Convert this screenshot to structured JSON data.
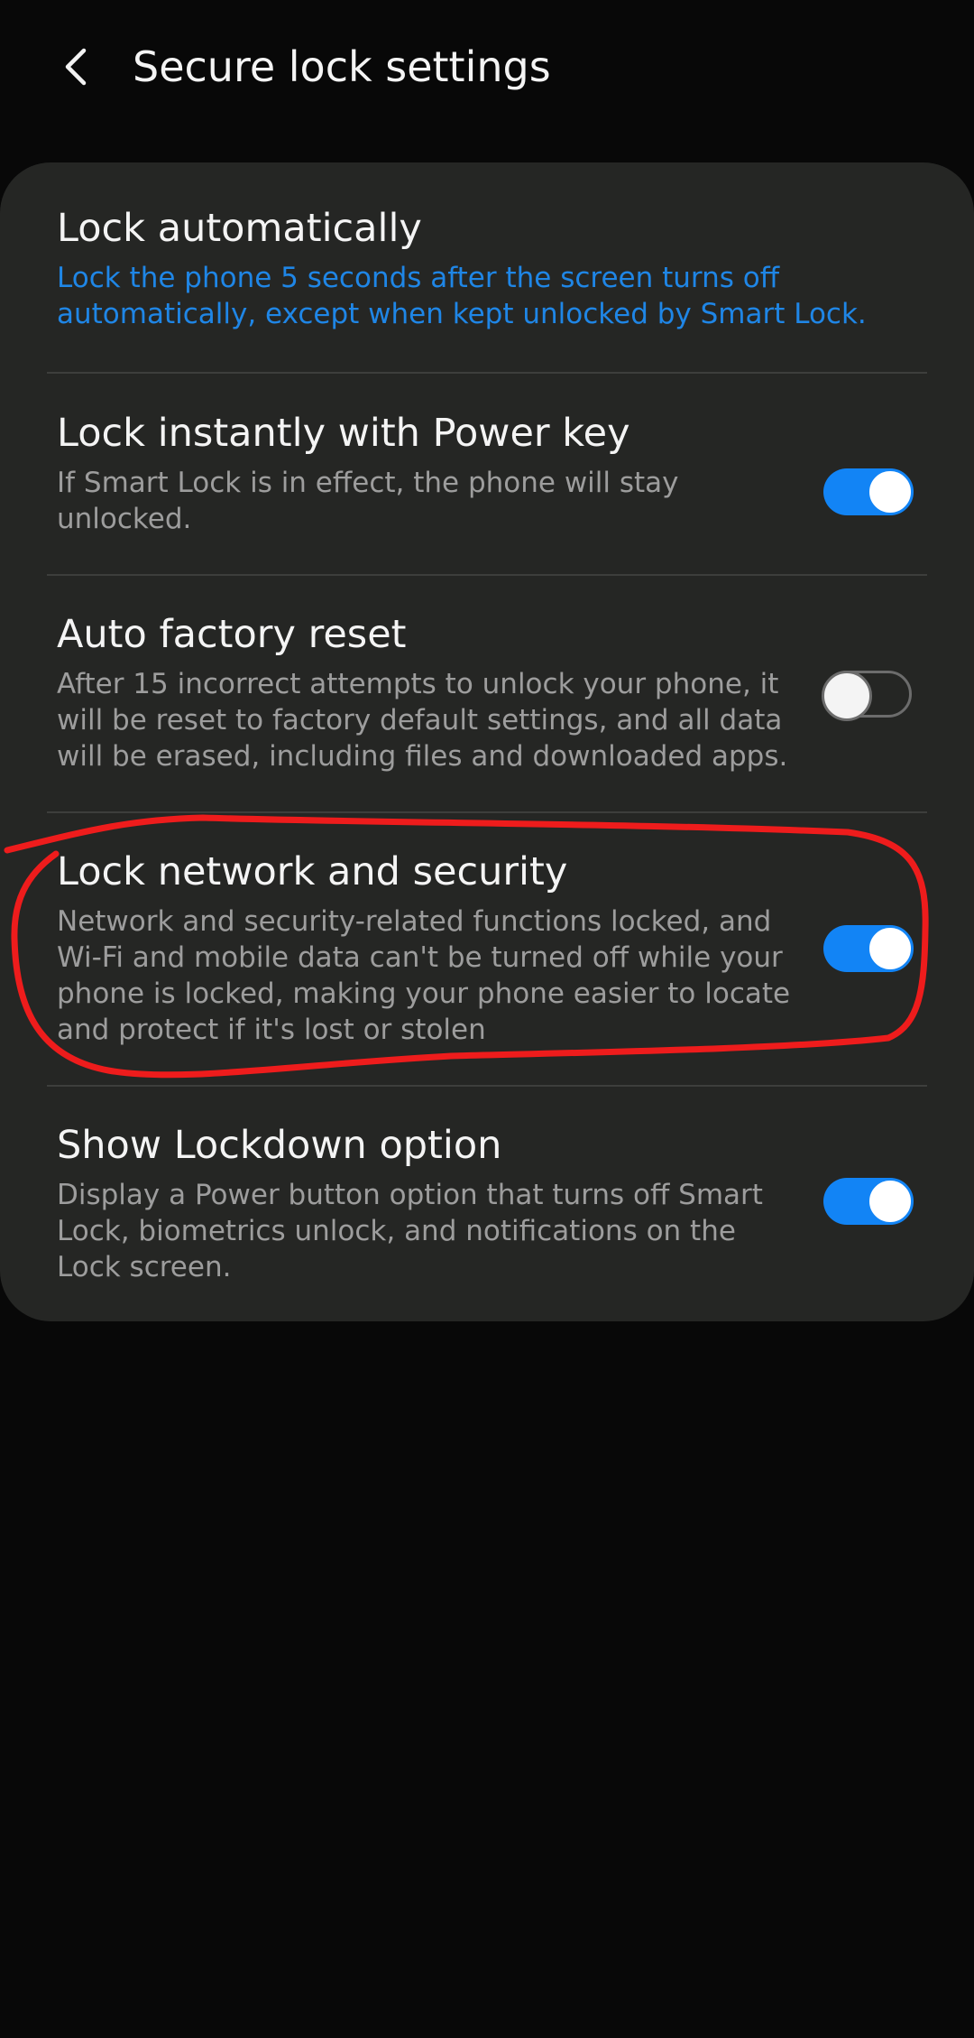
{
  "header": {
    "title": "Secure lock settings",
    "back_icon": "chevron-left-icon"
  },
  "settings": [
    {
      "title": "Lock automatically",
      "description": "Lock the phone 5 seconds after the screen turns off automatically, except when kept unlocked by Smart Lock."
    },
    {
      "title": "Lock instantly with Power key",
      "description": "If Smart Lock is in effect, the phone will stay unlocked.",
      "toggle": "on"
    },
    {
      "title": "Auto factory reset",
      "description": "After 15 incorrect attempts to unlock your phone, it will be reset to factory default settings, and all data will be erased, including files and downloaded apps.",
      "toggle": "off"
    },
    {
      "title": "Lock network and security",
      "description": "Network and security-related functions locked, and Wi-Fi and mobile data can't be turned off while your phone is locked, making your phone easier to locate and protect if it's lost or stolen",
      "toggle": "on"
    },
    {
      "title": "Show Lockdown option",
      "description": "Display a Power button option that turns off Smart Lock, biometrics unlock, and notifications on the Lock screen.",
      "toggle": "on"
    }
  ],
  "colors": {
    "background": "#080808",
    "card": "#252624",
    "accent": "#1f86e6",
    "toggle_on": "#1284f5",
    "annotation": "#ee1c1c"
  }
}
